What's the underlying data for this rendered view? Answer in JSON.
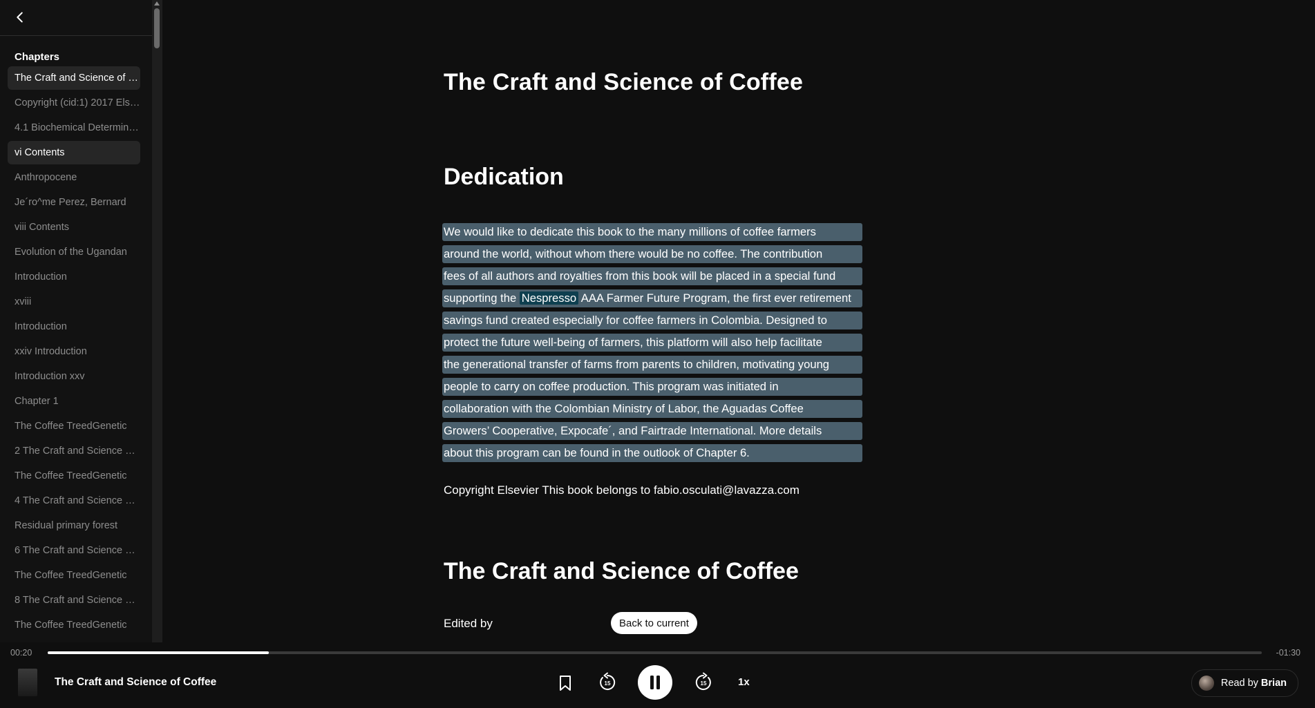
{
  "sidebar": {
    "heading": "Chapters",
    "items": [
      {
        "label": "The Craft and Science of Coffee",
        "active": true
      },
      {
        "label": "Copyright (cid:1) 2017 Elsevier Inc.",
        "active": false
      },
      {
        "label": "4.1 Biochemical Determinants",
        "active": false
      },
      {
        "label": "vi Contents",
        "active": true
      },
      {
        "label": "Anthropocene",
        "active": false
      },
      {
        "label": "Je´ro^me Perez, Bernard",
        "active": false
      },
      {
        "label": "viii Contents",
        "active": false
      },
      {
        "label": "Evolution of the Ugandan",
        "active": false
      },
      {
        "label": "Introduction",
        "active": false
      },
      {
        "label": "xviii",
        "active": false
      },
      {
        "label": "Introduction",
        "active": false
      },
      {
        "label": "xxiv Introduction",
        "active": false
      },
      {
        "label": "Introduction xxv",
        "active": false
      },
      {
        "label": "Chapter 1",
        "active": false
      },
      {
        "label": "The Coffee TreedGenetic",
        "active": false
      },
      {
        "label": "2 The Craft and Science of Coffee",
        "active": false
      },
      {
        "label": "The Coffee TreedGenetic",
        "active": false
      },
      {
        "label": "4 The Craft and Science of Coffee",
        "active": false
      },
      {
        "label": "Residual primary forest",
        "active": false
      },
      {
        "label": "6 The Craft and Science of Coffee",
        "active": false
      },
      {
        "label": "The Coffee TreedGenetic",
        "active": false
      },
      {
        "label": "8 The Craft and Science of Coffee",
        "active": false
      },
      {
        "label": "The Coffee TreedGenetic",
        "active": false
      }
    ]
  },
  "reader": {
    "title": "The Craft and Science of Coffee",
    "dedication_heading": "Dedication",
    "dedication_lines": [
      "We would like to dedicate this book to the many millions of coffee farmers",
      "around the world, without whom there would be no coffee. The contribution",
      "fees of all authors and royalties from this book will be placed in a special fund",
      {
        "before": "supporting the ",
        "highlight": "Nespresso",
        "after": " AAA Farmer Future Program, the first ever retirement"
      },
      "savings fund created especially for coffee farmers in Colombia. Designed to",
      "protect the future well-being of farmers, this platform will also help facilitate",
      "the generational transfer of farms from parents to children, motivating young",
      "people to carry on coffee production. This program was initiated in",
      "collaboration with the Colombian Ministry of Labor, the Aguadas Coffee",
      "Growers’ Cooperative, Expocafe´, and Fairtrade International. More details",
      "about this program can be found in the outlook of Chapter 6."
    ],
    "copyright": "Copyright Elsevier This book belongs to fabio.osculati@lavazza.com",
    "title_2": "The Craft and Science of Coffee",
    "edited_by": "Edited by",
    "back_to_current": "Back to current"
  },
  "player": {
    "elapsed": "00:20",
    "remaining": "-01:30",
    "progress": 0.182,
    "book_title": "The Craft and Science of Coffee",
    "speed": "1x",
    "read_by_prefix": "Read by",
    "narrator": "Brian"
  }
}
